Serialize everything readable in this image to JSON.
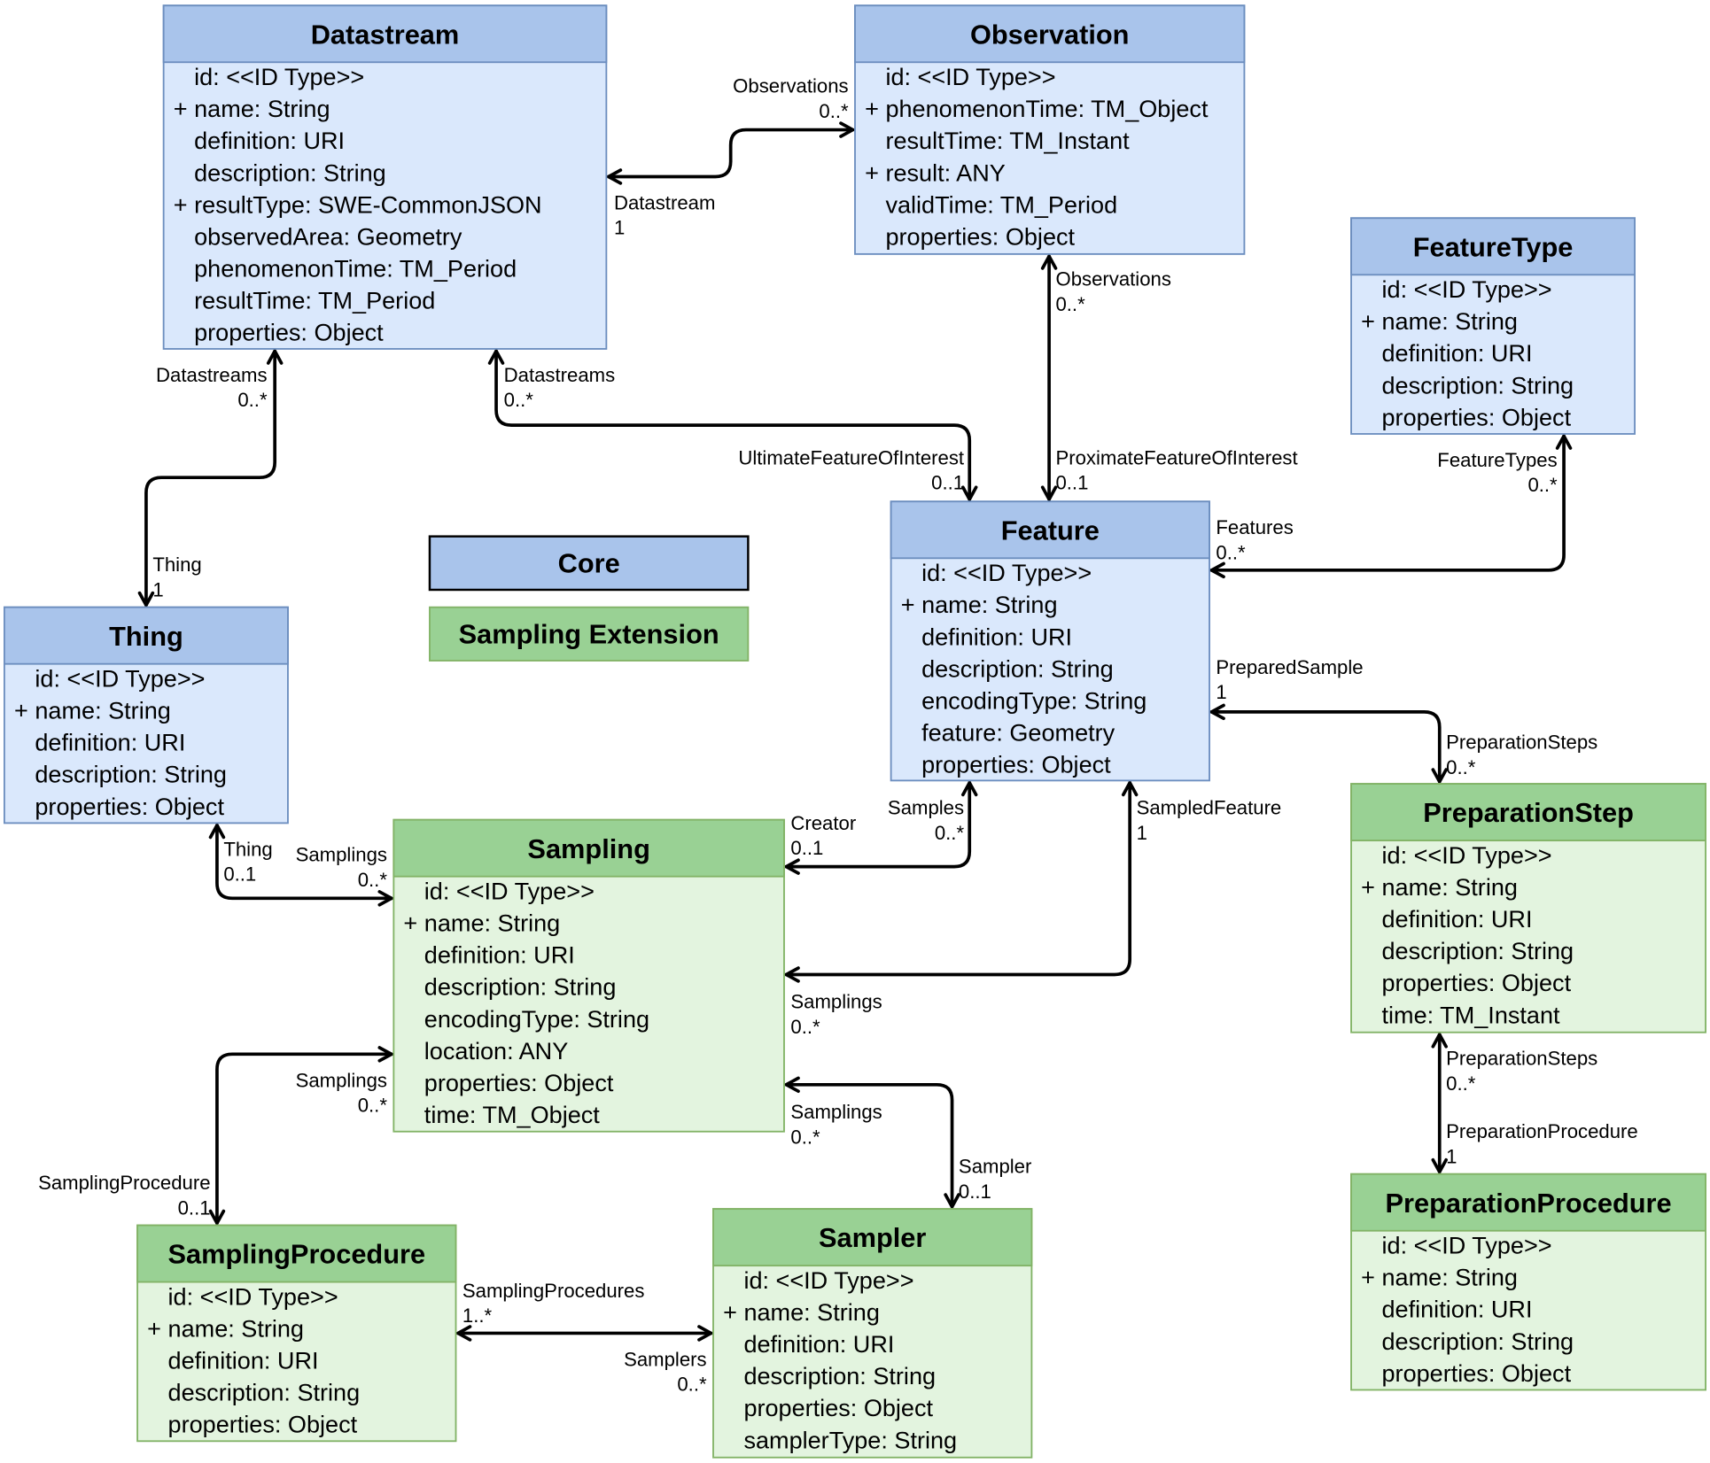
{
  "colors": {
    "core_header": "#a9c4eb",
    "core_body": "#dae8fc",
    "core_border": "#6c8ebf",
    "ext_header": "#99d194",
    "ext_body": "#e3f4df",
    "ext_border": "#82b366",
    "legend_core_border": "#000000"
  },
  "legend": {
    "core": "Core",
    "extension": "Sampling Extension"
  },
  "classes": [
    {
      "name": "Datastream",
      "theme": "core",
      "attributes": [
        {
          "vis": "",
          "text": "id: <<ID Type>>"
        },
        {
          "vis": "+",
          "text": "name: String"
        },
        {
          "vis": "",
          "text": "definition: URI"
        },
        {
          "vis": "",
          "text": "description: String"
        },
        {
          "vis": "+",
          "text": "resultType: SWE-CommonJSON"
        },
        {
          "vis": "",
          "text": "observedArea: Geometry"
        },
        {
          "vis": "",
          "text": "phenomenonTime: TM_Period"
        },
        {
          "vis": "",
          "text": "resultTime: TM_Period"
        },
        {
          "vis": "",
          "text": "properties: Object"
        }
      ]
    },
    {
      "name": "Observation",
      "theme": "core",
      "attributes": [
        {
          "vis": "",
          "text": "id: <<ID Type>>"
        },
        {
          "vis": "+",
          "text": "phenomenonTime: TM_Object"
        },
        {
          "vis": "",
          "text": "resultTime: TM_Instant"
        },
        {
          "vis": "+",
          "text": "result: ANY"
        },
        {
          "vis": "",
          "text": "validTime: TM_Period"
        },
        {
          "vis": "",
          "text": "properties: Object"
        }
      ]
    },
    {
      "name": "FeatureType",
      "theme": "core",
      "attributes": [
        {
          "vis": "",
          "text": "id: <<ID Type>>"
        },
        {
          "vis": "+",
          "text": "name: String"
        },
        {
          "vis": "",
          "text": "definition: URI"
        },
        {
          "vis": "",
          "text": "description: String"
        },
        {
          "vis": "",
          "text": "properties: Object"
        }
      ]
    },
    {
      "name": "Feature",
      "theme": "core",
      "attributes": [
        {
          "vis": "",
          "text": "id: <<ID Type>>"
        },
        {
          "vis": "+",
          "text": "name: String"
        },
        {
          "vis": "",
          "text": "definition: URI"
        },
        {
          "vis": "",
          "text": "description: String"
        },
        {
          "vis": "",
          "text": "encodingType: String"
        },
        {
          "vis": "",
          "text": "feature: Geometry"
        },
        {
          "vis": "",
          "text": "properties: Object"
        }
      ]
    },
    {
      "name": "Thing",
      "theme": "core",
      "attributes": [
        {
          "vis": "",
          "text": "id: <<ID Type>>"
        },
        {
          "vis": "+",
          "text": "name: String"
        },
        {
          "vis": "",
          "text": "definition: URI"
        },
        {
          "vis": "",
          "text": "description: String"
        },
        {
          "vis": "",
          "text": "properties: Object"
        }
      ]
    },
    {
      "name": "Sampling",
      "theme": "ext",
      "attributes": [
        {
          "vis": "",
          "text": "id: <<ID Type>>"
        },
        {
          "vis": "+",
          "text": "name: String"
        },
        {
          "vis": "",
          "text": "definition: URI"
        },
        {
          "vis": "",
          "text": "description: String"
        },
        {
          "vis": "",
          "text": "encodingType: String"
        },
        {
          "vis": "",
          "text": "location: ANY"
        },
        {
          "vis": "",
          "text": "properties: Object"
        },
        {
          "vis": "",
          "text": "time: TM_Object"
        }
      ]
    },
    {
      "name": "PreparationStep",
      "theme": "ext",
      "attributes": [
        {
          "vis": "",
          "text": "id: <<ID Type>>"
        },
        {
          "vis": "+",
          "text": "name: String"
        },
        {
          "vis": "",
          "text": "definition: URI"
        },
        {
          "vis": "",
          "text": "description: String"
        },
        {
          "vis": "",
          "text": "properties: Object"
        },
        {
          "vis": "",
          "text": "time: TM_Instant"
        }
      ]
    },
    {
      "name": "PreparationProcedure",
      "theme": "ext",
      "attributes": [
        {
          "vis": "",
          "text": "id: <<ID Type>>"
        },
        {
          "vis": "+",
          "text": "name: String"
        },
        {
          "vis": "",
          "text": "definition: URI"
        },
        {
          "vis": "",
          "text": "description: String"
        },
        {
          "vis": "",
          "text": "properties: Object"
        }
      ]
    },
    {
      "name": "SamplingProcedure",
      "theme": "ext",
      "attributes": [
        {
          "vis": "",
          "text": "id: <<ID Type>>"
        },
        {
          "vis": "+",
          "text": "name: String"
        },
        {
          "vis": "",
          "text": "definition: URI"
        },
        {
          "vis": "",
          "text": "description: String"
        },
        {
          "vis": "",
          "text": "properties: Object"
        }
      ]
    },
    {
      "name": "Sampler",
      "theme": "ext",
      "attributes": [
        {
          "vis": "",
          "text": "id: <<ID Type>>"
        },
        {
          "vis": "+",
          "text": "name: String"
        },
        {
          "vis": "",
          "text": "definition: URI"
        },
        {
          "vis": "",
          "text": "description: String"
        },
        {
          "vis": "",
          "text": "properties: Object"
        },
        {
          "vis": "",
          "text": "samplerType: String"
        }
      ]
    }
  ],
  "associations": [
    {
      "from": "Datastream",
      "to": "Observation",
      "labels": [
        [
          "Observations",
          "0..*"
        ],
        [
          "Datastream",
          "1"
        ]
      ]
    },
    {
      "from": "Datastream",
      "to": "Thing",
      "labels": [
        [
          "Datastreams",
          "0..*"
        ],
        [
          "Thing",
          "1"
        ]
      ]
    },
    {
      "from": "Datastream",
      "to": "Feature",
      "labels": [
        [
          "Datastreams",
          "0..*"
        ],
        [
          "UltimateFeatureOfInterest",
          "0..1"
        ]
      ]
    },
    {
      "from": "Observation",
      "to": "Feature",
      "labels": [
        [
          "Observations",
          "0..*"
        ],
        [
          "ProximateFeatureOfInterest",
          "0..1"
        ]
      ]
    },
    {
      "from": "FeatureType",
      "to": "Feature",
      "labels": [
        [
          "FeatureTypes",
          "0..*"
        ],
        [
          "Features",
          "0..*"
        ]
      ]
    },
    {
      "from": "Feature",
      "to": "PreparationStep",
      "labels": [
        [
          "PreparedSample",
          "1"
        ],
        [
          "PreparationSteps",
          "0..*"
        ]
      ]
    },
    {
      "from": "PreparationStep",
      "to": "PreparationProcedure",
      "labels": [
        [
          "PreparationSteps",
          "0..*"
        ],
        [
          "PreparationProcedure",
          "1"
        ]
      ]
    },
    {
      "from": "Thing",
      "to": "Sampling",
      "labels": [
        [
          "Thing",
          "0..1"
        ],
        [
          "Samplings",
          "0..*"
        ]
      ]
    },
    {
      "from": "Feature",
      "to": "Sampling",
      "labels": [
        [
          "Samples",
          "0..*"
        ],
        [
          "Creator",
          "0..1"
        ]
      ]
    },
    {
      "from": "Feature",
      "to": "Sampling",
      "labels": [
        [
          "SampledFeature",
          "1"
        ],
        [
          "Samplings",
          "0..*"
        ]
      ]
    },
    {
      "from": "Sampling",
      "to": "SamplingProcedure",
      "labels": [
        [
          "Samplings",
          "0..*"
        ],
        [
          "SamplingProcedure",
          "0..1"
        ]
      ]
    },
    {
      "from": "Sampling",
      "to": "Sampler",
      "labels": [
        [
          "Samplings",
          "0..*"
        ],
        [
          "Sampler",
          "0..1"
        ]
      ]
    },
    {
      "from": "SamplingProcedure",
      "to": "Sampler",
      "labels": [
        [
          "SamplingProcedures",
          "1..*"
        ],
        [
          "Samplers",
          "0..*"
        ]
      ]
    }
  ]
}
